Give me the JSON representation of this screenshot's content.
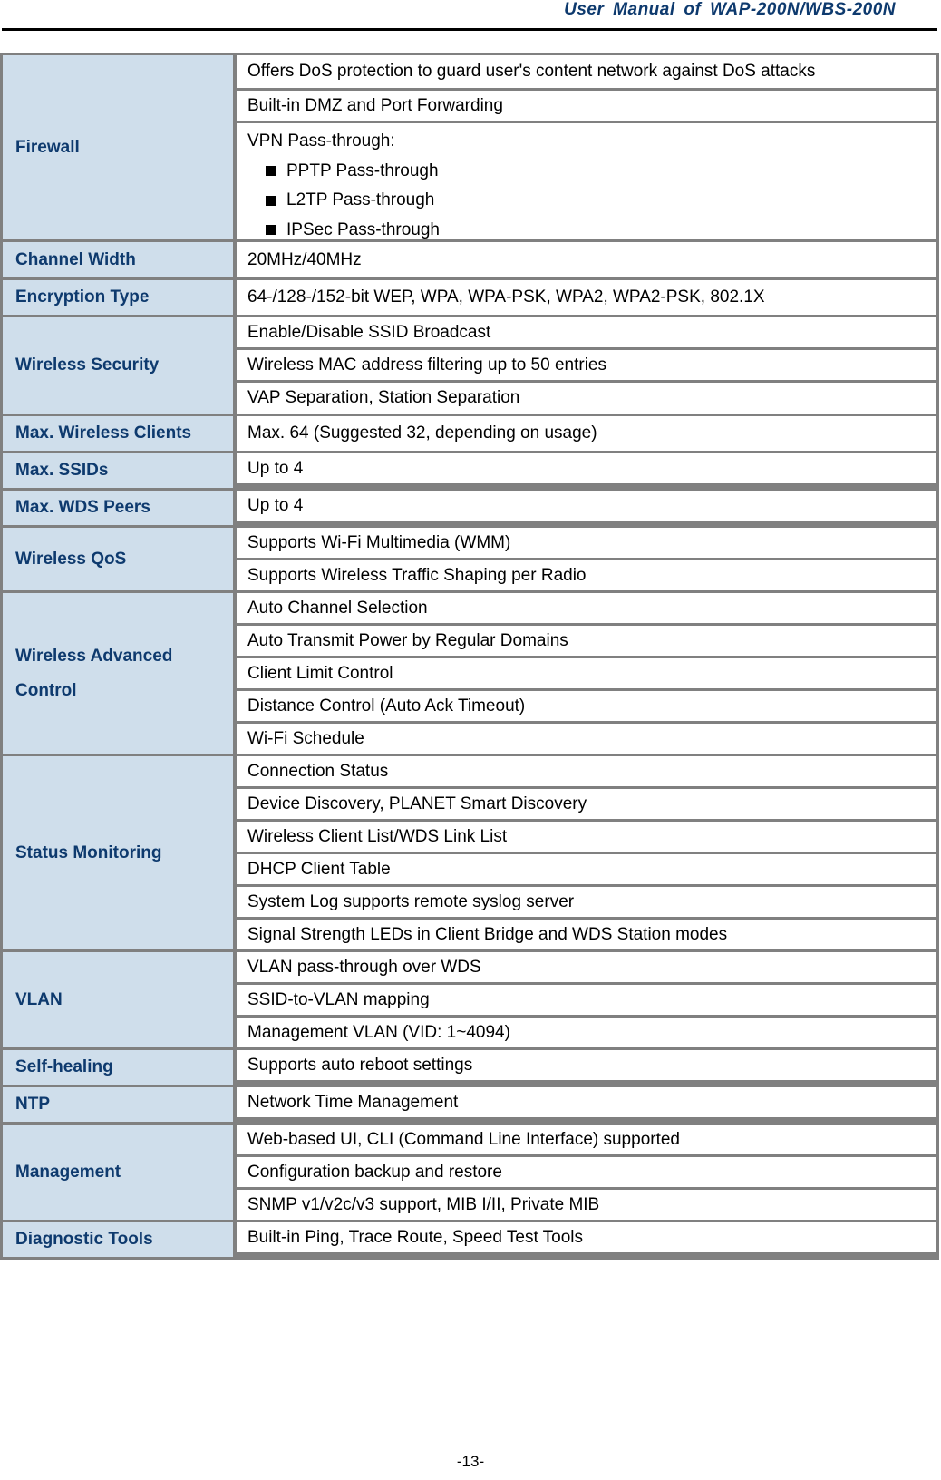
{
  "header": {
    "title": "User Manual of WAP-200N/WBS-200N"
  },
  "table": {
    "groups": [
      {
        "label": "Firewall",
        "values": [
          "Offers DoS protection to guard user's content network against DoS attacks",
          "Built-in DMZ and Port Forwarding"
        ],
        "vpn": {
          "title": "VPN Pass-through:",
          "bullets": [
            "PPTP Pass-through",
            "L2TP Pass-through",
            "IPSec Pass-through"
          ]
        }
      },
      {
        "label": "Channel Width",
        "values": [
          "20MHz/40MHz"
        ]
      },
      {
        "label": "Encryption Type",
        "values": [
          "64-/128-/152-bit WEP, WPA, WPA-PSK, WPA2, WPA2-PSK, 802.1X"
        ]
      },
      {
        "label": "Wireless Security",
        "values": [
          "Enable/Disable SSID Broadcast",
          "Wireless MAC address filtering up to 50 entries",
          "VAP Separation, Station Separation"
        ]
      },
      {
        "label": "Max. Wireless Clients",
        "values": [
          "Max. 64 (Suggested 32, depending on usage)"
        ]
      },
      {
        "label": "Max. SSIDs",
        "values": [
          "Up to 4"
        ]
      },
      {
        "label": "Max. WDS Peers",
        "values": [
          "Up to 4"
        ]
      },
      {
        "label": "Wireless QoS",
        "values": [
          "Supports Wi-Fi Multimedia (WMM)",
          "Supports Wireless Traffic Shaping per Radio"
        ]
      },
      {
        "label": "Wireless Advanced Control",
        "values": [
          "Auto Channel Selection",
          "Auto Transmit Power by Regular Domains",
          "Client Limit Control",
          "Distance Control (Auto Ack Timeout)",
          "Wi-Fi Schedule"
        ]
      },
      {
        "label": "Status Monitoring",
        "values": [
          "Connection Status",
          "Device Discovery, PLANET Smart Discovery",
          "Wireless Client List/WDS Link List",
          "DHCP Client Table",
          "System Log supports remote syslog server",
          "Signal Strength LEDs in Client Bridge and WDS Station modes"
        ]
      },
      {
        "label": "VLAN",
        "values": [
          "VLAN pass-through over WDS",
          "SSID-to-VLAN mapping",
          "Management VLAN (VID: 1~4094)"
        ]
      },
      {
        "label": "Self-healing",
        "values": [
          "Supports auto reboot settings"
        ]
      },
      {
        "label": "NTP",
        "values": [
          "Network Time Management"
        ]
      },
      {
        "label": "Management",
        "values": [
          "Web-based UI, CLI (Command Line Interface) supported",
          "Configuration backup and restore",
          "SNMP v1/v2c/v3 support, MIB I/II, Private MIB"
        ]
      },
      {
        "label": "Diagnostic Tools",
        "values": [
          "Built-in Ping, Trace Route, Speed Test Tools"
        ]
      }
    ]
  },
  "footer": {
    "page_number": "-13-"
  }
}
